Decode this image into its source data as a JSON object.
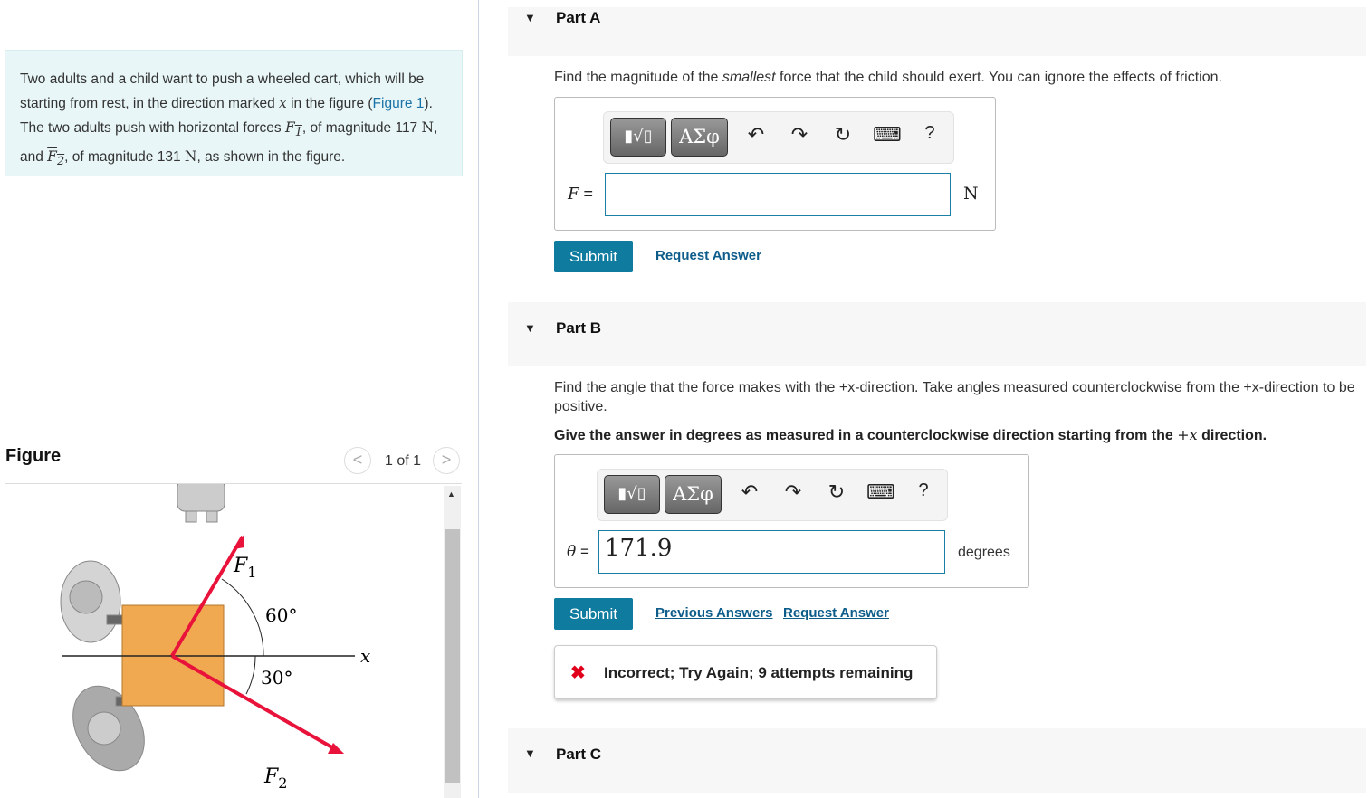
{
  "problem": {
    "t1": "Two adults and a child want to push a wheeled cart, which will be starting from rest, in the direction marked ",
    "x": "x",
    "t2": " in the figure (",
    "link": "Figure 1",
    "t3": "). The two adults push with horizontal forces ",
    "F1": "F",
    "sub1": "1",
    "t4": ", of magnitude ",
    "mag1": "117",
    "unitN": "N",
    "t5": ", and ",
    "F2": "F",
    "sub2": "2",
    "t6": ", of magnitude ",
    "mag2": "131",
    "t7": ", as shown in the figure."
  },
  "figure": {
    "heading": "Figure",
    "pager": "1 of 1",
    "prev": "<",
    "next": ">",
    "labels": {
      "f1": "F",
      "f1sub": "1",
      "f2": "F",
      "f2sub": "2",
      "a60": "60°",
      "a30": "30°",
      "x": "x"
    },
    "colors": {
      "force": "#e8123a",
      "cart": "#f0a851"
    }
  },
  "partA": {
    "label": "Part A",
    "prompt_pre": "Find the magnitude of the ",
    "prompt_em": "smallest",
    "prompt_post": " force that the child should exert. You can ignore the effects of friction.",
    "var": "F",
    "eq": "=",
    "value": "",
    "unit": "N",
    "submit": "Submit",
    "request": "Request Answer"
  },
  "toolbar": {
    "templates": "▮√▯",
    "greek": "ΑΣφ",
    "undo": "↶",
    "redo": "↷",
    "reset": "↻",
    "keyboard": "⌨",
    "help": "?"
  },
  "partB": {
    "label": "Part B",
    "prompt": "Find the angle that the force makes with the +x-direction. Take angles measured counterclockwise from the +x-direction to be positive.",
    "bold_pre": "Give the answer in degrees as measured in a counterclockwise direction starting from the ",
    "bold_x": "+x",
    "bold_post": " direction.",
    "var": "θ",
    "eq": "=",
    "value": "171.9",
    "unit": "degrees",
    "submit": "Submit",
    "previous": "Previous Answers",
    "request": "Request Answer",
    "feedback": "Incorrect; Try Again; 9 attempts remaining",
    "feedback_icon": "✖"
  },
  "partC": {
    "label": "Part C"
  },
  "colors": {
    "accent": "#0f7b9e",
    "error": "#e0001b"
  }
}
